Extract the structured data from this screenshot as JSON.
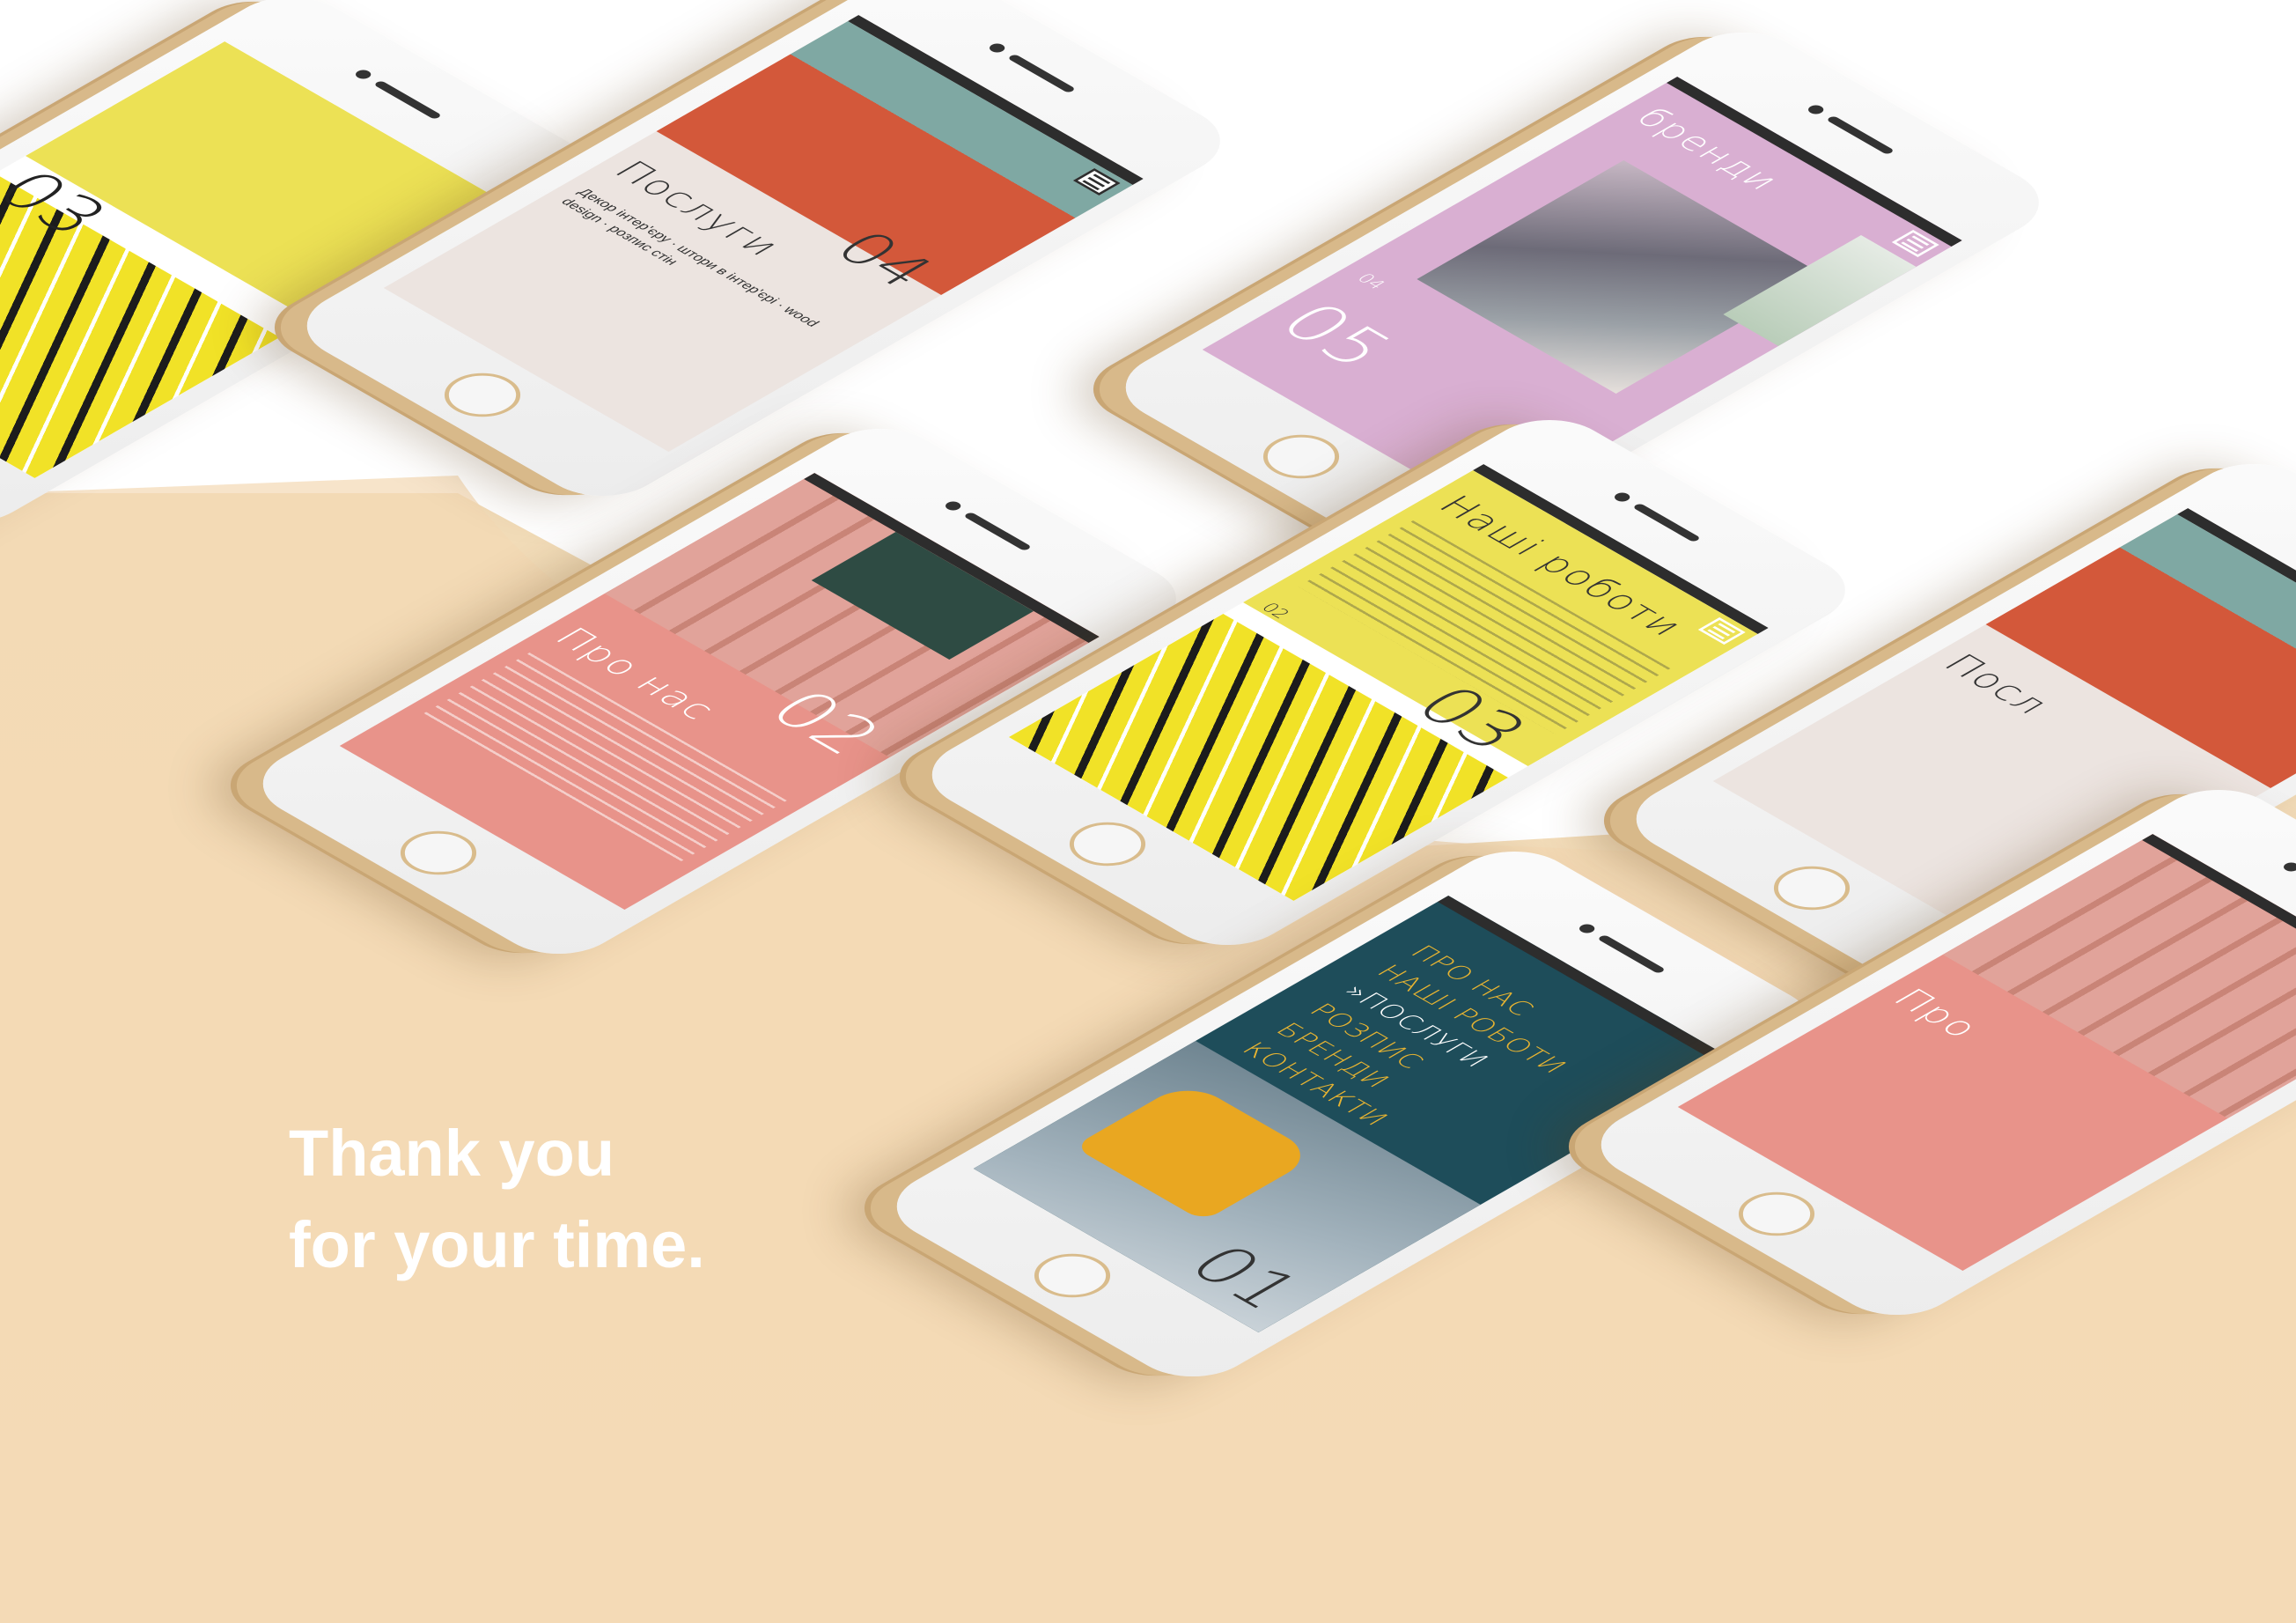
{
  "headline": {
    "line1": "Thank you",
    "line2": "for your time."
  },
  "screens": {
    "works_partial": {
      "number": "03"
    },
    "services": {
      "title": "Послуги",
      "number": "04",
      "tags": [
        "Декор інтер'єру",
        "штори в інтер'єрі",
        "wood design",
        "розпис стін"
      ]
    },
    "brands": {
      "title": "бренди",
      "number": "05",
      "prev_number": "04"
    },
    "about": {
      "title": "Про нас",
      "number": "02"
    },
    "works": {
      "title": "Наші роботи",
      "number": "03",
      "prev_number": "02"
    },
    "menu": {
      "items": [
        "ПРО НАС",
        "НАШІ РОБОТИ",
        "»ПОСЛУГИ",
        "РОЗПИС",
        "БРЕНДИ",
        "КОНТАКТИ"
      ],
      "number": "01"
    },
    "services_partial": {
      "title": "Посл"
    },
    "about_partial": {
      "title": "Про"
    }
  },
  "colors": {
    "background_top": "#ffffff",
    "background_floor": "#f1d7b0",
    "yellow": "#ece155",
    "pink": "#e8938a",
    "lilac": "#d9afd2",
    "beige_panel": "#ece4e0",
    "teal": "#1e4d5a",
    "gold_frame": "#d6b684"
  }
}
